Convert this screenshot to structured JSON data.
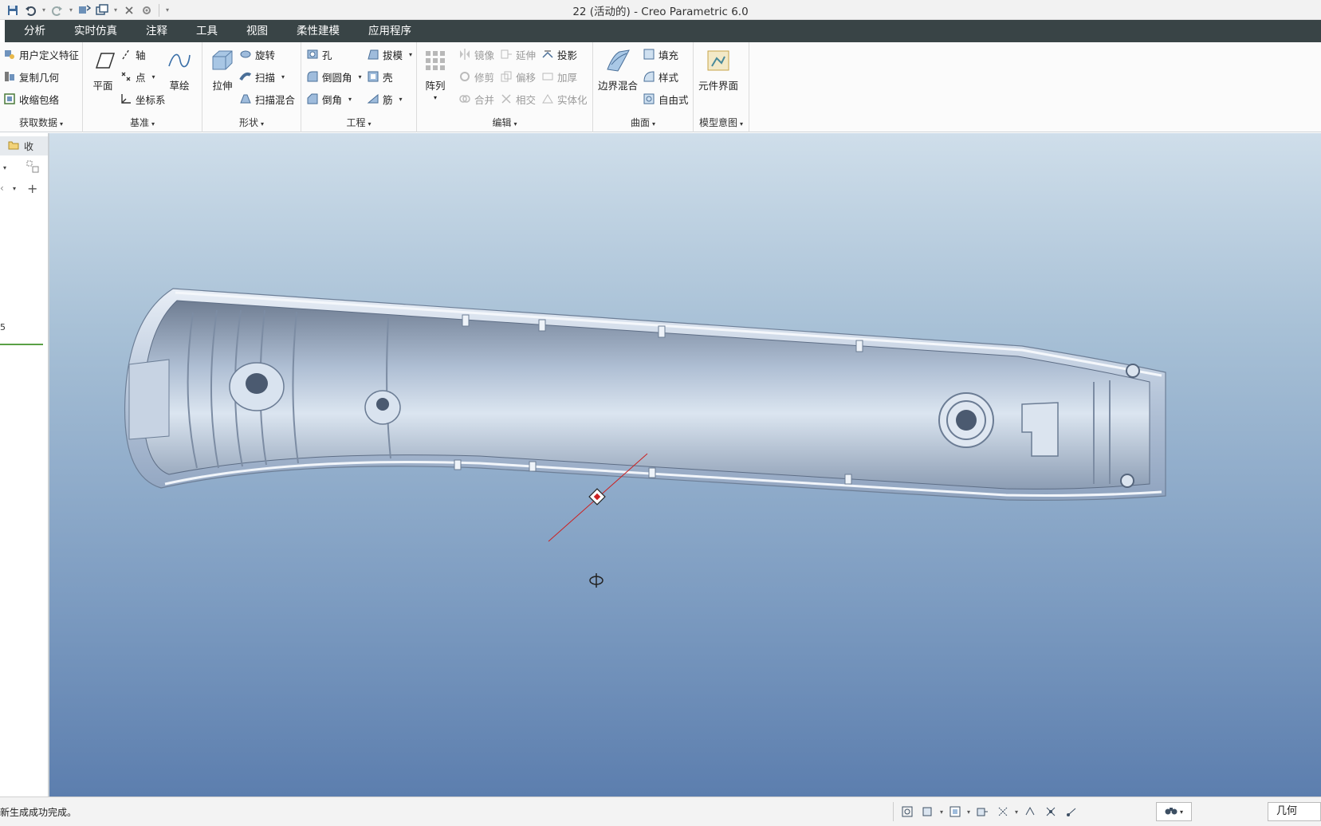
{
  "window": {
    "title": "22 (活动的) - Creo Parametric 6.0"
  },
  "tabs": [
    {
      "label": "分析"
    },
    {
      "label": "实时仿真"
    },
    {
      "label": "注释"
    },
    {
      "label": "工具"
    },
    {
      "label": "视图"
    },
    {
      "label": "柔性建模"
    },
    {
      "label": "应用程序"
    }
  ],
  "ribbon": {
    "get_data": {
      "label": "获取数据",
      "items": {
        "udf": "用户定义特征",
        "copy_geom": "复制几何",
        "shrinkwrap": "收缩包络"
      }
    },
    "datum": {
      "label": "基准",
      "plane": "平面",
      "axis": "轴",
      "point": "点",
      "csys": "坐标系",
      "sketch": "草绘"
    },
    "shapes": {
      "label": "形状",
      "extrude": "拉伸",
      "revolve": "旋转",
      "sweep": "扫描",
      "swept_blend": "扫描混合"
    },
    "engineering": {
      "label": "工程",
      "hole": "孔",
      "round": "倒圆角",
      "chamfer": "倒角",
      "draft": "拔模",
      "shell": "壳",
      "rib": "筋"
    },
    "editing": {
      "label": "编辑",
      "pattern": "阵列",
      "mirror": "镜像",
      "trim": "修剪",
      "merge": "合并",
      "extend": "延伸",
      "offset": "偏移",
      "intersect": "相交",
      "project": "投影",
      "thicken": "加厚",
      "solidify": "实体化"
    },
    "surfaces": {
      "label": "曲面",
      "boundary_blend": "边界混合",
      "fill": "填充",
      "style": "样式",
      "freestyle": "自由式"
    },
    "model_intent": {
      "label": "模型意图",
      "component_interface": "元件界面"
    }
  },
  "left_panel": {
    "tab_label": "收",
    "row_number": "5"
  },
  "status": {
    "message": "新生成成功完成。",
    "filter_value": "几何"
  },
  "colors": {
    "tabbar_bg": "#394446",
    "viewport_top": "#cfdeea",
    "viewport_bottom": "#5c7eae",
    "accent_red": "#cc2020"
  }
}
